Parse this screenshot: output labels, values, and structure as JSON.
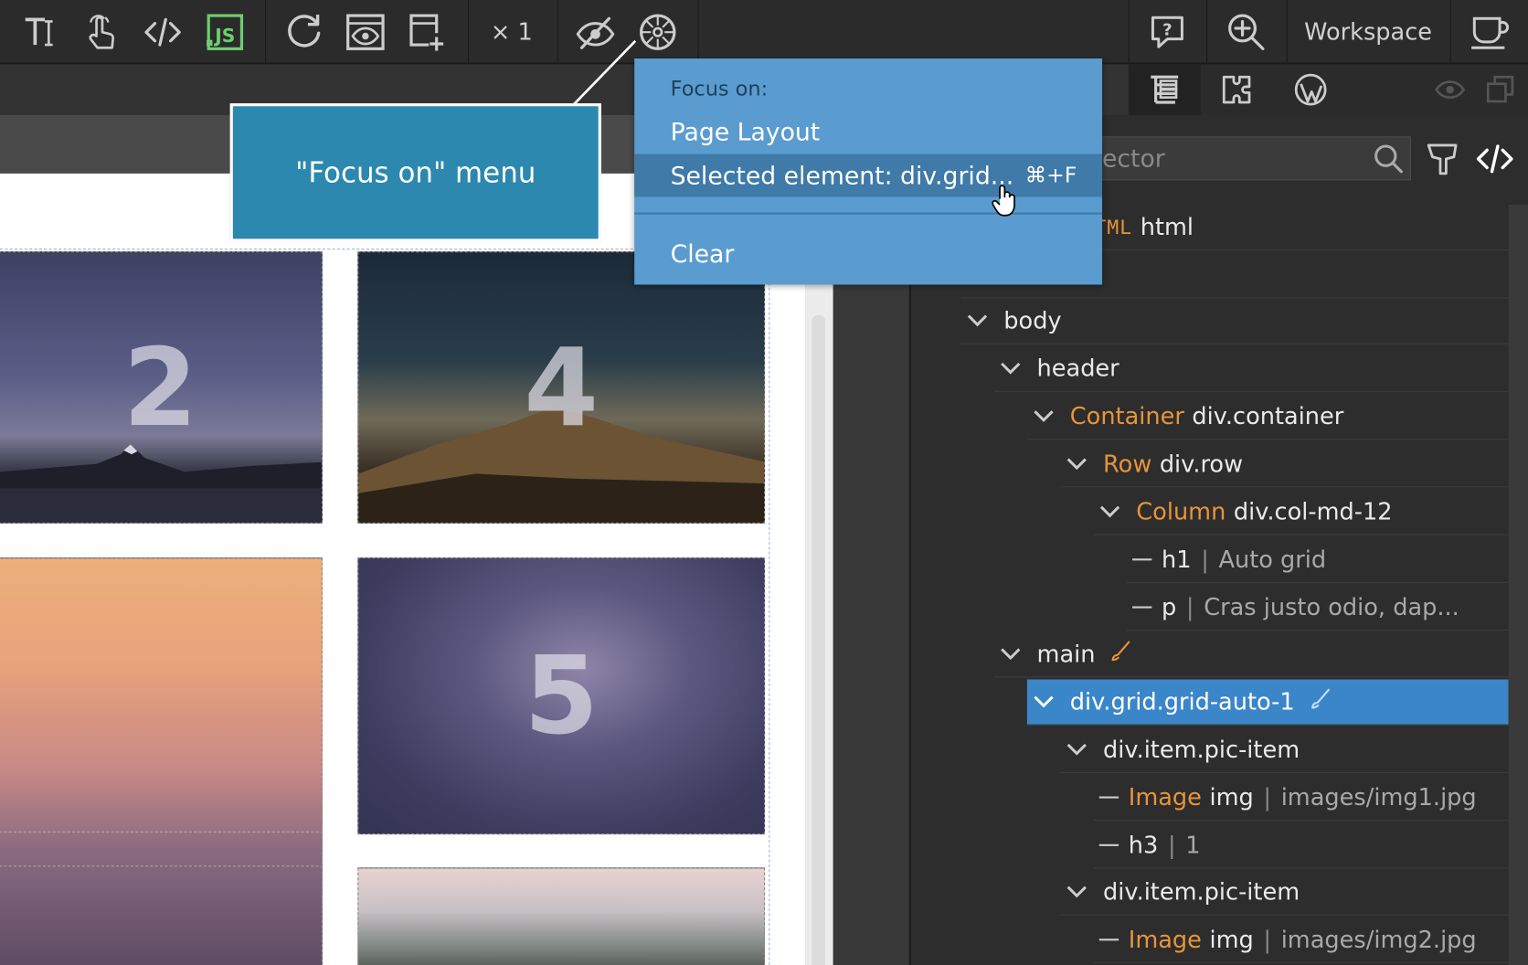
{
  "toolbar": {
    "multiplier": "× 1",
    "workspace_label": "Workspace"
  },
  "filter": {
    "placeholder": "Filter by selector",
    "visible_text": "ector"
  },
  "callout": {
    "label": "\"Focus on\" menu"
  },
  "focus_menu": {
    "heading": "Focus on:",
    "items": [
      {
        "label": "Page Layout",
        "shortcut": ""
      },
      {
        "label": "Selected element: div.grid...",
        "shortcut": "⌘+F"
      },
      {
        "label": "Clear",
        "shortcut": ""
      }
    ]
  },
  "canvas": {
    "pictures": [
      {
        "number": "2"
      },
      {
        "number": "4"
      },
      {
        "number": "5"
      },
      {
        "number": ""
      },
      {
        "number": ""
      }
    ]
  },
  "tree": {
    "rows": [
      {
        "type": "HTML",
        "tag": "html",
        "desc": ""
      },
      {
        "type": "",
        "tag": "body",
        "desc": ""
      },
      {
        "type": "",
        "tag": "header",
        "desc": ""
      },
      {
        "type": "Container",
        "tag": "div.container",
        "desc": ""
      },
      {
        "type": "Row",
        "tag": "div.row",
        "desc": ""
      },
      {
        "type": "Column",
        "tag": "div.col-md-12",
        "desc": ""
      },
      {
        "type": "",
        "tag": "h1",
        "desc": "Auto grid"
      },
      {
        "type": "",
        "tag": "p",
        "desc": "Cras justo odio, dap..."
      },
      {
        "type": "",
        "tag": "main",
        "desc": ""
      },
      {
        "type": "",
        "tag": "div.grid.grid-auto-1",
        "desc": ""
      },
      {
        "type": "",
        "tag": "div.item.pic-item",
        "desc": ""
      },
      {
        "type": "Image",
        "tag": "img",
        "desc": "images/img1.jpg"
      },
      {
        "type": "",
        "tag": "h3",
        "desc": "1"
      },
      {
        "type": "",
        "tag": "div.item.pic-item",
        "desc": ""
      },
      {
        "type": "Image",
        "tag": "img",
        "desc": "images/img2.jpg"
      }
    ]
  },
  "colors": {
    "menu_bg": "#5a9ccf",
    "menu_highlight": "#3f7aa8",
    "callout_bg": "#2c88ae",
    "selected_row": "#3b86c8",
    "type_label": "#e8943a",
    "js_icon": "#6fce6f"
  }
}
